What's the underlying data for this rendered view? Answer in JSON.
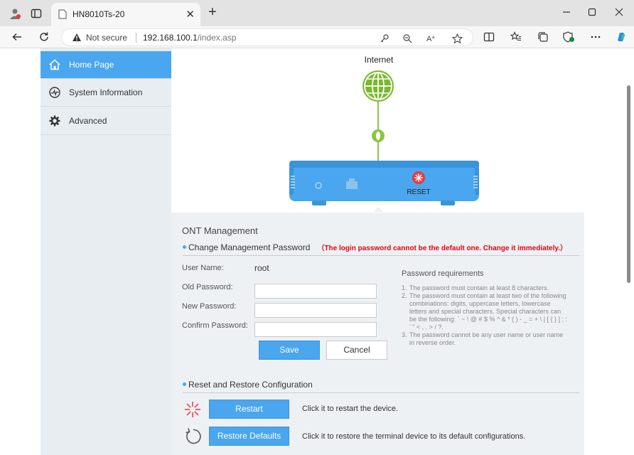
{
  "browser": {
    "tab_title": "HN8010Ts-20",
    "not_secure": "Not secure",
    "url_host": "192.168.100.1",
    "url_path": "/index.asp",
    "new_tab": "+",
    "tab_close": "✕"
  },
  "sidebar": {
    "items": [
      {
        "label": "Home Page",
        "icon": "home-icon",
        "active": true
      },
      {
        "label": "System Information",
        "icon": "gauge-icon",
        "active": false
      },
      {
        "label": "Advanced",
        "icon": "gear-icon",
        "active": false
      }
    ]
  },
  "diagram": {
    "internet_label": "Internet",
    "reset_label": "RESET",
    "globe_color": "#7ab82e",
    "device_color": "#4aa6ee"
  },
  "ont": {
    "title": "ONT Management",
    "change_pw": {
      "heading": "Change Management Password",
      "warning": "（The login password cannot be the default one. Change it immediately.）",
      "username_label": "User Name:",
      "username_value": "root",
      "old_label": "Old Password:",
      "new_label": "New Password:",
      "confirm_label": "Confirm Password:",
      "old_value": "",
      "new_value": "",
      "confirm_value": "",
      "save_label": "Save",
      "cancel_label": "Cancel"
    },
    "requirements": {
      "title": "Password requirements",
      "items": [
        "The password must contain at least 8 characters.",
        "The password must contain at least two of the following combinations: digits, uppercase letters, lowercase letters and special characters. Special characters can be the following: ` ~ ! @ # $ % ^ & * ( ) - _ = + \\ | [ { } ] ; : ' \" < , . > / ?.",
        "The password cannot be any user name or user name in reverse order."
      ]
    },
    "reset": {
      "heading": "Reset and Restore Configuration",
      "restart_label": "Restart",
      "restart_desc": "Click it to restart the device.",
      "restore_label": "Restore Defaults",
      "restore_desc": "Click it to restore the terminal device to its default configurations."
    }
  },
  "colors": {
    "accent": "#4aa6ee",
    "warning": "#e60012",
    "sidebar_bg": "#e8edf2"
  }
}
